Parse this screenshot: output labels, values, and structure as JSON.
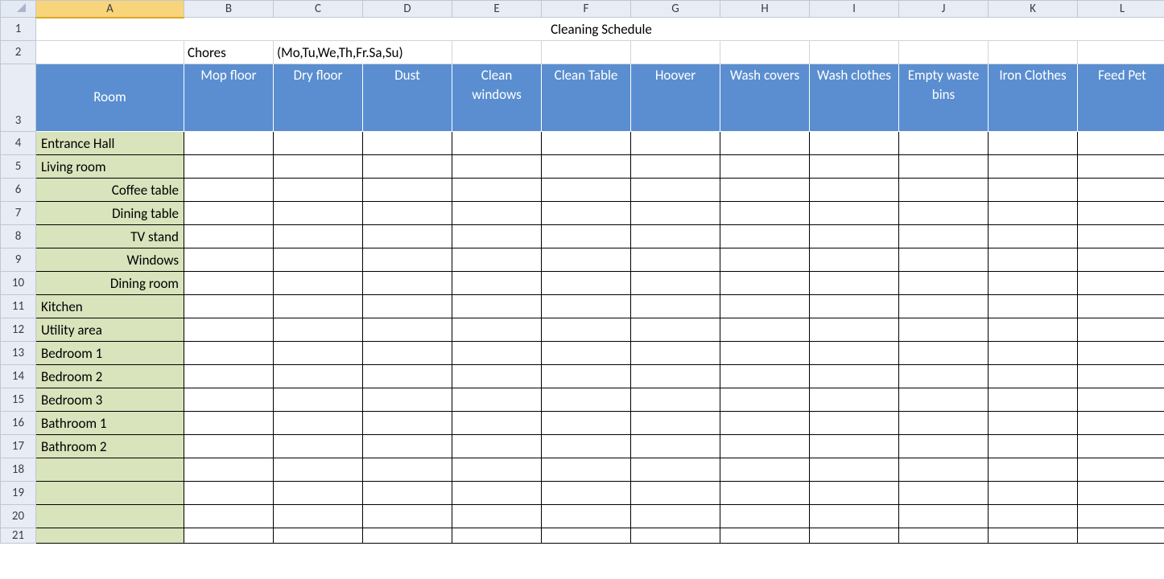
{
  "columns": [
    "A",
    "B",
    "C",
    "D",
    "E",
    "F",
    "G",
    "H",
    "I",
    "J",
    "K",
    "L"
  ],
  "active_column": "A",
  "row_numbers": [
    1,
    2,
    3,
    4,
    5,
    6,
    7,
    8,
    9,
    10,
    11,
    12,
    13,
    14,
    15,
    16,
    17,
    18,
    19,
    20,
    21
  ],
  "title": "Cleaning Schedule",
  "row2": {
    "B": "Chores",
    "C_merge": "(Mo,Tu,We,Th,Fr.Sa,Su)"
  },
  "headers": [
    "Room",
    "Mop floor",
    "Dry floor",
    "Dust",
    "Clean windows",
    "Clean Table",
    "Hoover",
    "Wash covers",
    "Wash clothes",
    "Empty waste bins",
    "Iron Clothes",
    "Feed Pet"
  ],
  "rooms": [
    {
      "label": "Entrance Hall",
      "align": "left"
    },
    {
      "label": "Living room",
      "align": "left"
    },
    {
      "label": "Coffee table",
      "align": "right"
    },
    {
      "label": "Dining table",
      "align": "right"
    },
    {
      "label": "TV stand",
      "align": "right"
    },
    {
      "label": "Windows",
      "align": "right"
    },
    {
      "label": "Dining room",
      "align": "right"
    },
    {
      "label": "Kitchen",
      "align": "left"
    },
    {
      "label": "Utility area",
      "align": "left"
    },
    {
      "label": "Bedroom 1",
      "align": "left"
    },
    {
      "label": "Bedroom 2",
      "align": "left"
    },
    {
      "label": "Bedroom 3",
      "align": "left"
    },
    {
      "label": "Bathroom 1",
      "align": "left"
    },
    {
      "label": "Bathroom 2",
      "align": "left"
    },
    {
      "label": "",
      "align": "left"
    },
    {
      "label": "",
      "align": "left"
    },
    {
      "label": "",
      "align": "left"
    },
    {
      "label": "",
      "align": "left"
    }
  ],
  "colwidths": {
    "gutter": 44,
    "A": 184,
    "rest": 111
  }
}
